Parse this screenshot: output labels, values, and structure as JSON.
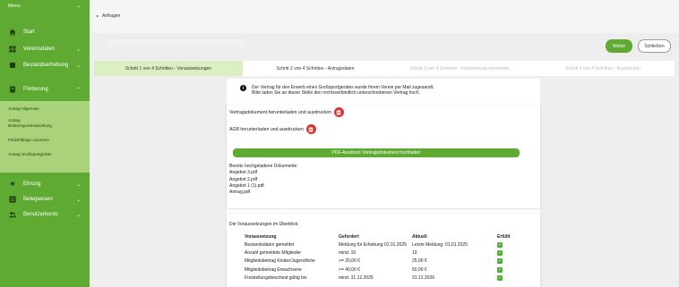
{
  "sidebar": {
    "menu_label": "Menu",
    "items": [
      {
        "label": "Start",
        "icon": "home-icon"
      },
      {
        "label": "Vereinsdaten",
        "icon": "grid-icon"
      },
      {
        "label": "Bestandserhebung",
        "icon": "square-icon"
      },
      {
        "label": "Förderung",
        "icon": "document-icon"
      },
      {
        "label": "Ehrung",
        "icon": "star-icon"
      },
      {
        "label": "Belegwesen",
        "icon": "list-icon"
      },
      {
        "label": "Benutzerkonto",
        "icon": "users-icon"
      }
    ],
    "sub_items": [
      "Antrag Allgemein",
      "Antrag Breitensportentwicklung",
      "Förderfähige Lizenzen",
      "Antrag Großsportgeräte"
    ]
  },
  "breadcrumb": {
    "item": "Anfragen"
  },
  "buttons": {
    "weiter": "Weiter",
    "schliessen": "Schließen"
  },
  "steps": [
    "Schritt 1 von 4 Schritten - Voraussetzungen",
    "Schritt 2 von 4 Schritten - Antragsdaten",
    "Schritt 3 von 4 Schritten - Förderantrag versenden",
    "Schritt 4 von 4 Schritten - Ausdrucken"
  ],
  "info": {
    "line1": "Der Vertrag für den Erwerb eines Großsportgerätes wurde Ihrem Verein per Mail zugesandt.",
    "line2": "Bitte laden Sie an dieser Stelle den rechtsverbindlich unterschriebenen Vertrag hoch."
  },
  "documents": {
    "contract_download": "Vertragsdokument herunterladen und ausdrucken",
    "agb_download": "AGB herunterladen und ausdrucken",
    "upload_button": "PDF-Ausdruck Vertragsdokument hochladen",
    "uploaded_title": "Bereits hochgeladene Dokumente:",
    "uploaded": [
      "Angebot 3.pdf",
      "Angebot 2.pdf",
      "Angebot 1 (1).pdf",
      "Antrag.pdf"
    ]
  },
  "requirements": {
    "title": "Die Voraussetzungen im Überblick:",
    "headers": [
      "Voraussetzung",
      "Gefordert",
      "Aktuell",
      "Erfüllt"
    ],
    "rows": [
      [
        "Bestandsdaten gemeldet",
        "Meldung für Erhebung 01.01.2025",
        "Letzte Meldung: 01.01.2025"
      ],
      [
        "Anzahl gemeldete Mitglieder",
        "mind. 10",
        "19"
      ],
      [
        "Mitgliedsbeitrag Kinder/Jugendliche",
        ">= 20,00 €",
        "25,00 €"
      ],
      [
        "Mitgliedsbeitrag Erwachsene",
        ">= 40,00 €",
        "50,00 €"
      ],
      [
        "Freistellungsbescheid gültig bis",
        "mind. 31.12.2025",
        "31.12.2026"
      ]
    ]
  }
}
